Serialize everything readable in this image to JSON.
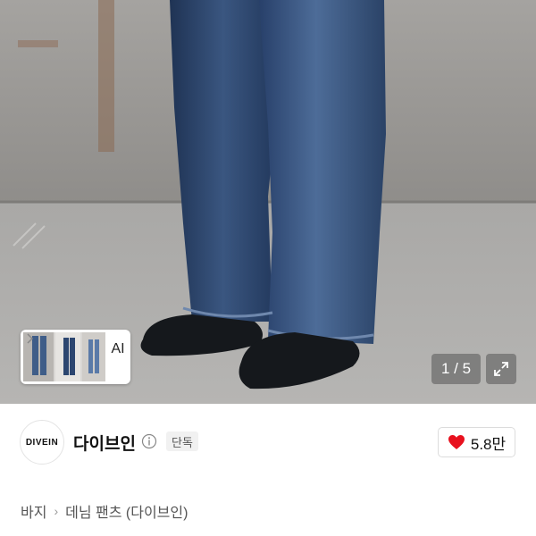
{
  "gallery": {
    "thumbnail_label": "AI",
    "counter_text": "1 / 5"
  },
  "brand": {
    "logo_text": "DIVEIN",
    "name": "다이브인",
    "badge": "단독"
  },
  "like": {
    "count": "5.8만",
    "heart_color": "#e8111e"
  },
  "breadcrumb": {
    "items": [
      "바지",
      "데님 팬츠 (다이브인)"
    ]
  },
  "icons": {
    "info": "info-icon",
    "expand": "expand-icon",
    "heart": "heart-icon",
    "chevron": "chevron-right-icon"
  }
}
